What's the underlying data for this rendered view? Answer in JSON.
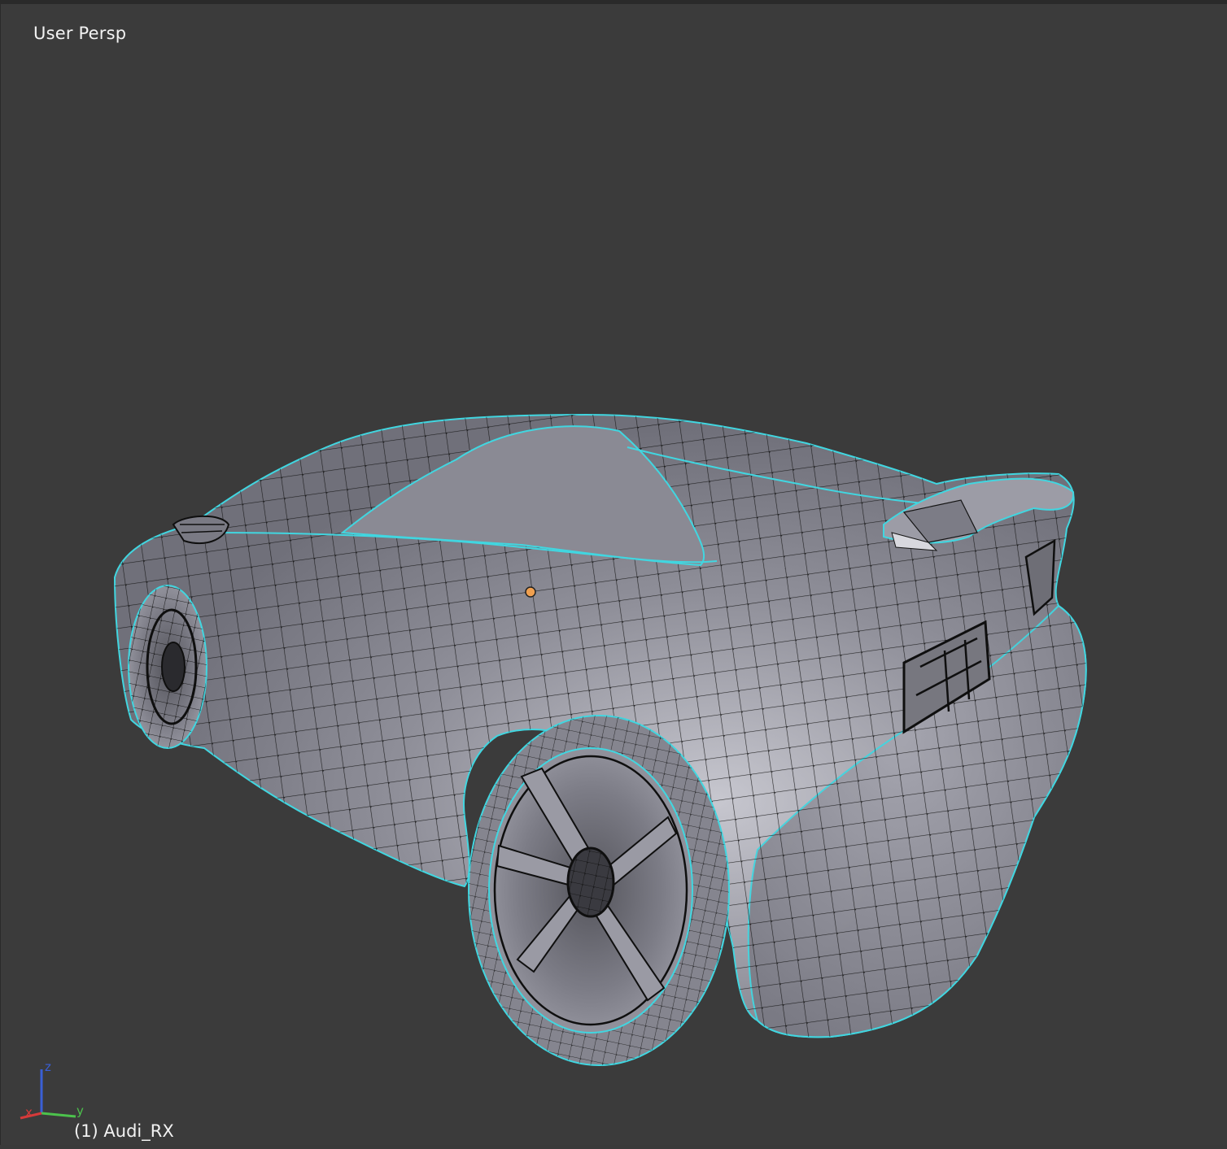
{
  "viewport": {
    "view_name": "User Persp",
    "object_name": "(1) Audi_RX"
  },
  "axes": {
    "x_label": "x",
    "y_label": "y",
    "z_label": "z",
    "x_color": "#d63a3a",
    "y_color": "#4cc24c",
    "z_color": "#3a5fd6"
  },
  "colors": {
    "background": "#3b3b3b",
    "mesh_face": "#8e8e98",
    "mesh_edge": "#101010",
    "seam_edge": "#41d6e0",
    "origin_dot": "#f0a050"
  },
  "mesh": {
    "object_type": "car-wireframe-mesh",
    "icon": "origin-dot"
  }
}
